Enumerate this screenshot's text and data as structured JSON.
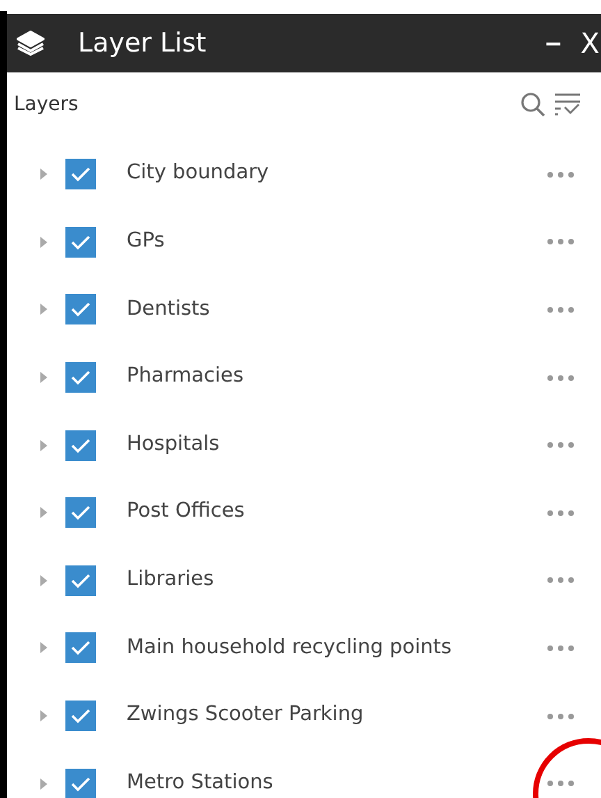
{
  "window": {
    "title": "Layer List",
    "minimize": "–",
    "close": "X"
  },
  "header": {
    "label": "Layers"
  },
  "layers": [
    {
      "name": "City boundary",
      "checked": true
    },
    {
      "name": "GPs",
      "checked": true
    },
    {
      "name": "Dentists",
      "checked": true
    },
    {
      "name": "Pharmacies",
      "checked": true
    },
    {
      "name": "Hospitals",
      "checked": true
    },
    {
      "name": "Post Offices",
      "checked": true
    },
    {
      "name": "Libraries",
      "checked": true
    },
    {
      "name": "Main household recycling points",
      "checked": true
    },
    {
      "name": "Zwings Scooter Parking",
      "checked": true
    },
    {
      "name": "Metro Stations",
      "checked": true
    }
  ]
}
